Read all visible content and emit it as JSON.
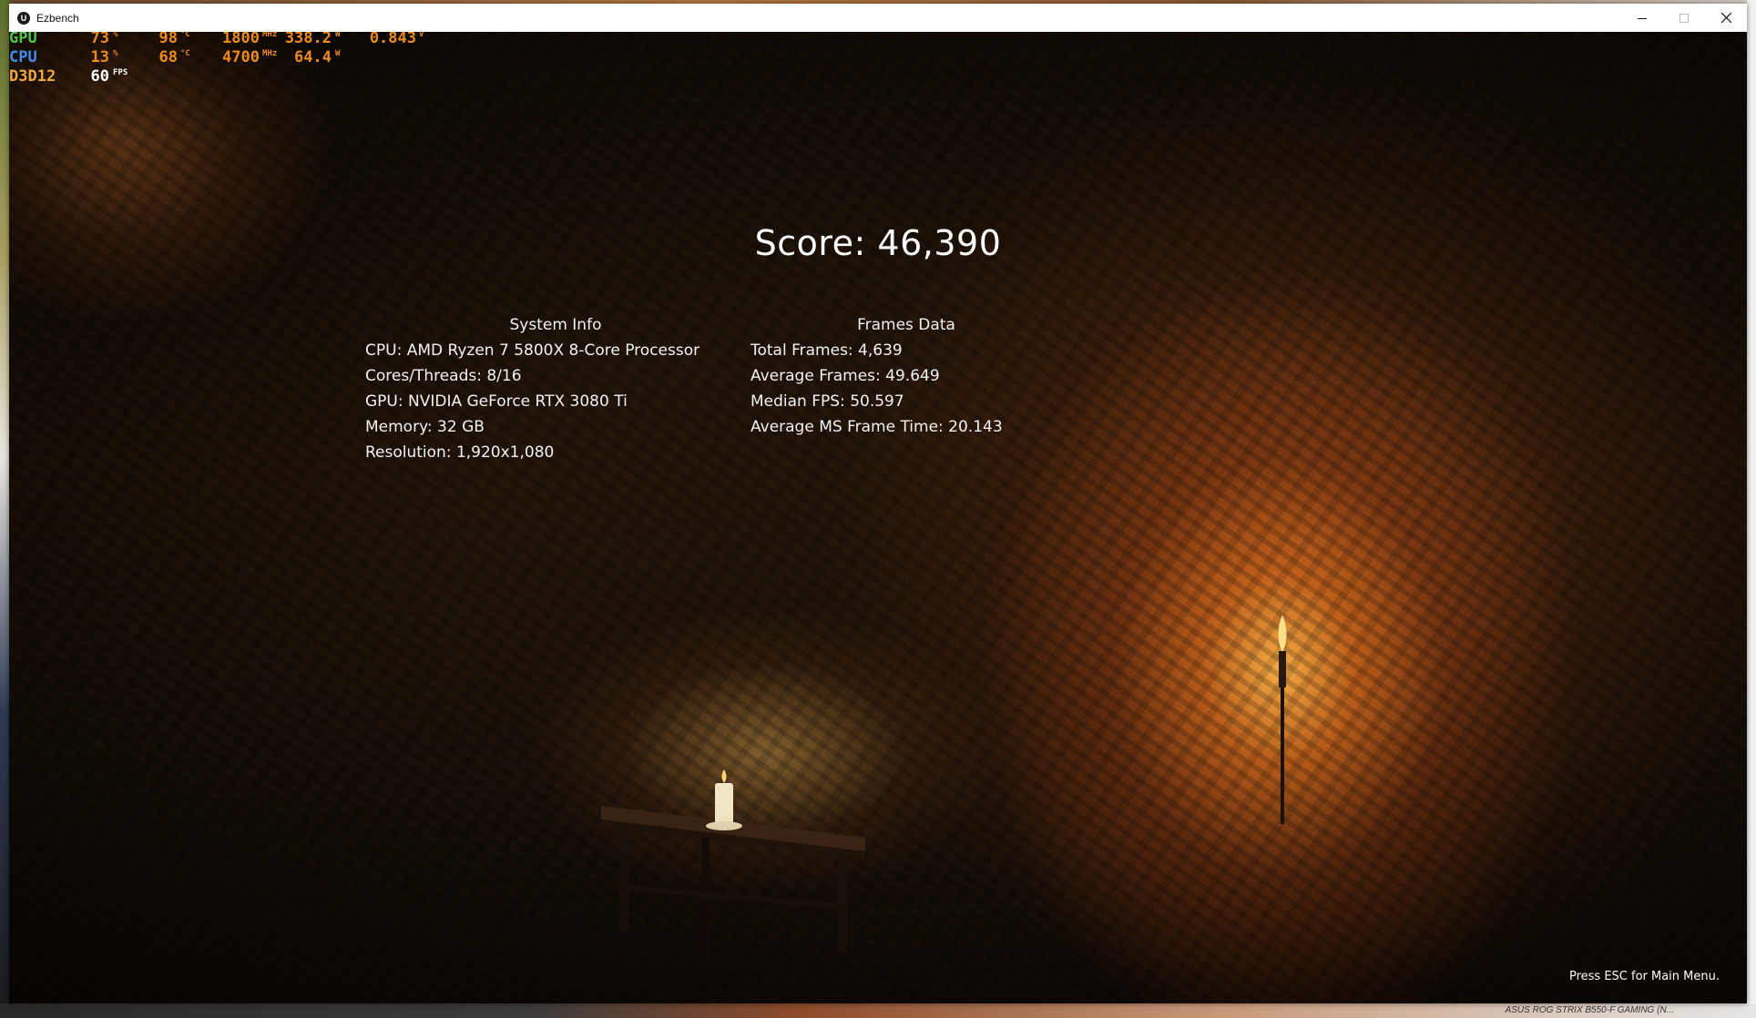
{
  "window": {
    "app_icon_letter": "U",
    "title": "Ezbench",
    "controls": [
      "minimize",
      "maximize",
      "close"
    ]
  },
  "osd": {
    "rows": [
      {
        "label": "GPU",
        "label_color": "#4fc24a",
        "util": "73",
        "util_unit": "%",
        "temp": "98",
        "temp_unit": "°C",
        "clock": "1800",
        "clock_unit": "MHz",
        "power": "338.2",
        "power_unit": "W",
        "voltage": "0.843",
        "voltage_unit": "V"
      },
      {
        "label": "CPU",
        "label_color": "#3d8ef0",
        "util": "13",
        "util_unit": "%",
        "temp": "68",
        "temp_unit": "°C",
        "clock": "4700",
        "clock_unit": "MHz",
        "power": "64.4",
        "power_unit": "W"
      },
      {
        "label": "D3D12",
        "label_color": "#f0a83c",
        "fps": "60",
        "fps_unit": "FPS"
      }
    ]
  },
  "score": {
    "text": "Score: 46,390"
  },
  "system_info": {
    "title": "System Info",
    "lines": [
      "CPU: AMD Ryzen 7 5800X 8-Core Processor",
      "Cores/Threads: 8/16",
      "GPU: NVIDIA GeForce RTX 3080 Ti",
      "Memory: 32 GB",
      "Resolution: 1,920x1,080"
    ]
  },
  "frames_data": {
    "title": "Frames Data",
    "lines": [
      "Total Frames: 4,639",
      "Average Frames: 49.649",
      "Median FPS: 50.597",
      "Average MS Frame Time: 20.143"
    ]
  },
  "hint": "Press ESC for Main Menu.",
  "taskbar_text": "ASUS ROG STRIX B550-F GAMING (N..."
}
